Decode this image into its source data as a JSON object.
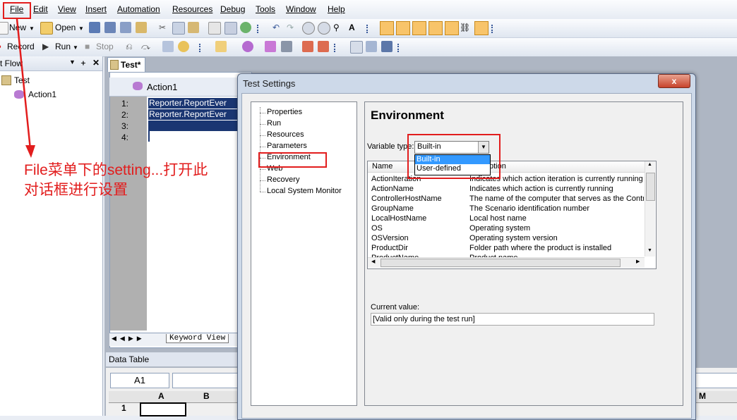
{
  "menu": [
    "File",
    "Edit",
    "View",
    "Insert",
    "Automation",
    "Resources",
    "Debug",
    "Tools",
    "Window",
    "Help"
  ],
  "toolbar1": {
    "new_label": "New",
    "open_label": "Open"
  },
  "toolbar2": {
    "record_label": "Record",
    "run_label": "Run",
    "stop_label": "Stop"
  },
  "left_pane": {
    "title": "t Flow",
    "tree_root": "Test",
    "tree_child": "Action1"
  },
  "document_tab": "Test*",
  "editor": {
    "action_name": "Action1",
    "line_numbers": [
      "1:",
      "2:",
      "3:",
      "4:"
    ],
    "lines": [
      "Reporter.ReportEver",
      "Reporter.ReportEver"
    ],
    "keyword_view_tab": "Keyword View"
  },
  "data_table": {
    "title": "Data Table",
    "cell_ref": "A1",
    "columns": [
      "A",
      "B"
    ],
    "row1": "1",
    "far_column": "M"
  },
  "dialog": {
    "title": "Test Settings",
    "close_glyph": "x",
    "nav": [
      "Properties",
      "Run",
      "Resources",
      "Parameters",
      "Environment",
      "Web",
      "Recovery",
      "Local System Monitor"
    ],
    "panel_title": "Environment",
    "variable_type_label": "Variable type:",
    "variable_type_value": "Built-in",
    "dropdown_options": [
      "Built-in",
      "User-defined"
    ],
    "list_headers": [
      "Name",
      "Description"
    ],
    "list_header_desc_visible": "ption",
    "rows": [
      {
        "name": "ActionIteration",
        "desc": "Indicates which action iteration is currently running"
      },
      {
        "name": "ActionName",
        "desc": "Indicates which action is currently running"
      },
      {
        "name": "ControllerHostName",
        "desc": "The name of the computer that serves as the Control"
      },
      {
        "name": "GroupName",
        "desc": "The Scenario identification number"
      },
      {
        "name": "LocalHostName",
        "desc": "Local host name"
      },
      {
        "name": "OS",
        "desc": "Operating system"
      },
      {
        "name": "OSVersion",
        "desc": "Operating system version"
      },
      {
        "name": "ProductDir",
        "desc": "Folder path where the product is installed"
      },
      {
        "name": "ProductName",
        "desc": "Product name"
      }
    ],
    "current_value_label": "Current value:",
    "current_value": "[Valid only during the test run]"
  },
  "annotation": {
    "text_line1": "File菜单下的setting...打开此",
    "text_line2": "对话框进行设置",
    "color": "#e21d1d"
  }
}
